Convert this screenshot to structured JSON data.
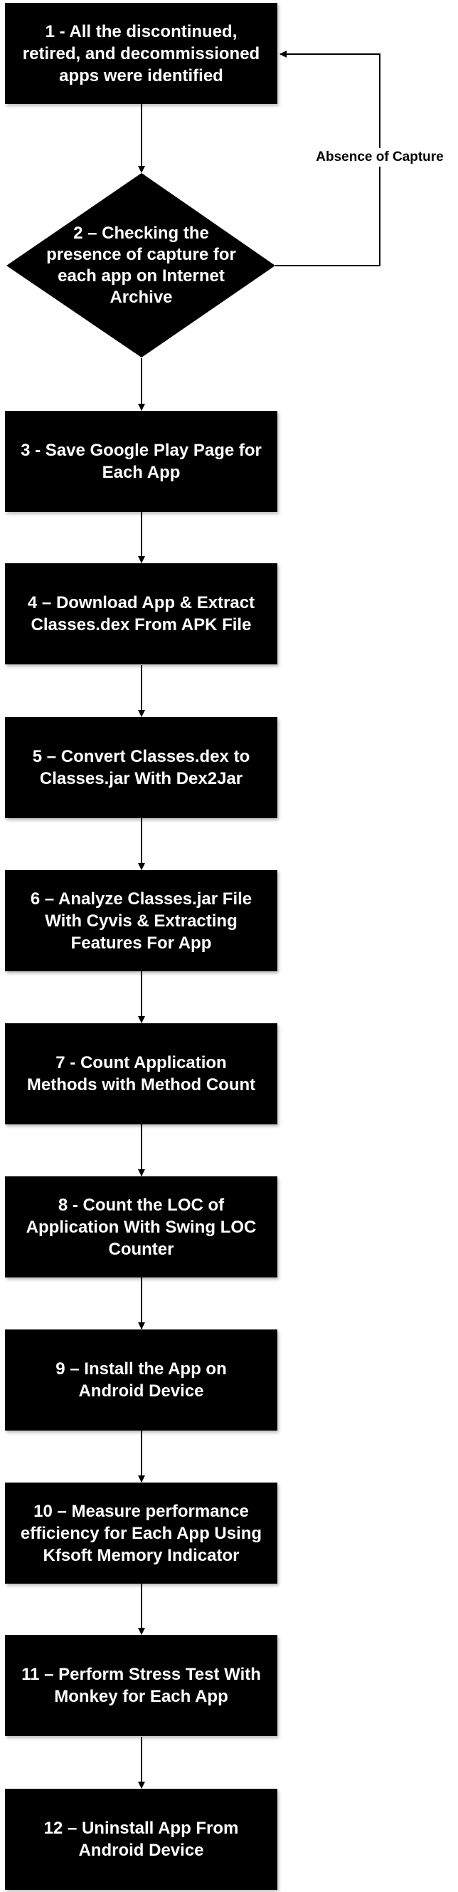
{
  "flowchart": {
    "steps": [
      "1 - All the discontinued,\nretired, and decommissioned\napps were identified",
      "2 – Checking the\npresence of capture for\neach app on Internet\nArchive",
      "3 - Save Google Play Page for\nEach App",
      "4 – Download App & Extract\nClasses.dex From APK File",
      "5 – Convert Classes.dex to\nClasses.jar With Dex2Jar",
      "6 – Analyze Classes.jar File\nWith Cyvis & Extracting\nFeatures For App",
      "7 - Count Application\nMethods with Method Count",
      "8 - Count the LOC of\nApplication With Swing LOC\nCounter",
      "9 – Install the App on\nAndroid Device",
      "10 – Measure performance\nefficiency for Each App Using\nKfsoft Memory Indicator",
      "11 – Perform Stress Test With\nMonkey for Each App",
      "12 – Uninstall App From\nAndroid Device"
    ],
    "feedback_label": "Absence of Capture",
    "colors": {
      "node_fill": "#000000",
      "node_text": "#ffffff",
      "connector": "#000000"
    }
  }
}
